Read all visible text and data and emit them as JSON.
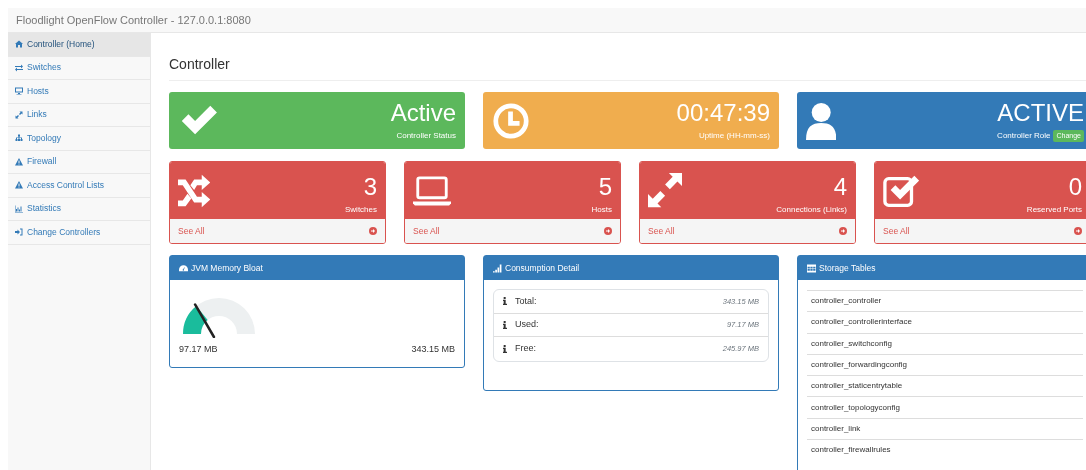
{
  "navbar": {
    "brand": "Floodlight OpenFlow Controller - 127.0.0.1:8080"
  },
  "sidebar": {
    "items": [
      {
        "label": "Controller (Home)",
        "selected": true
      },
      {
        "label": "Switches",
        "selected": false
      },
      {
        "label": "Hosts",
        "selected": false
      },
      {
        "label": "Links",
        "selected": false
      },
      {
        "label": "Topology",
        "selected": false
      },
      {
        "label": "Firewall",
        "selected": false
      },
      {
        "label": "Access Control Lists",
        "selected": false
      },
      {
        "label": "Statistics",
        "selected": false
      },
      {
        "label": "Change Controllers",
        "selected": false
      }
    ]
  },
  "heading": "Controller",
  "status_cards": [
    {
      "value": "Active",
      "caption": "Controller Status",
      "color": "#5cb85c"
    },
    {
      "value": "00:47:39",
      "caption": "Uptime (HH-mm-ss)",
      "color": "#f0ad4e"
    },
    {
      "value": "ACTIVE",
      "caption": "Controller Role",
      "color": "#337ab7",
      "button": "Change"
    }
  ],
  "count_cards": [
    {
      "value": "3",
      "caption": "Switches",
      "link": "See All"
    },
    {
      "value": "5",
      "caption": "Hosts",
      "link": "See All"
    },
    {
      "value": "4",
      "caption": "Connections (Links)",
      "link": "See All"
    },
    {
      "value": "0",
      "caption": "Reserved Ports",
      "link": "See All"
    }
  ],
  "memory": {
    "title": "JVM Memory Bloat",
    "used": "97.17 MB",
    "total": "343.15 MB"
  },
  "consumption": {
    "title": "Consumption Detail",
    "rows": [
      {
        "label": "Total:",
        "value": "343.15 MB"
      },
      {
        "label": "Used:",
        "value": "97.17 MB"
      },
      {
        "label": "Free:",
        "value": "245.97 MB"
      }
    ]
  },
  "storage": {
    "title": "Storage Tables",
    "rows": [
      "controller_controller",
      "controller_controllerinterface",
      "controller_switchconfig",
      "controller_forwardingconfig",
      "controller_staticentrytable",
      "controller_topologyconfig",
      "controller_link",
      "controller_firewallrules"
    ]
  }
}
